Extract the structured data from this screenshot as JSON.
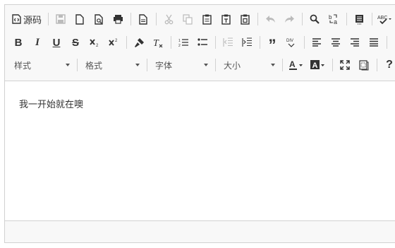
{
  "toolbar": {
    "source_label": "源码",
    "styles_label": "样式",
    "format_label": "格式",
    "font_label": "字体",
    "size_label": "大小"
  },
  "content": {
    "text": "我一开始就在噢"
  },
  "colors": {
    "toolbar_bg": "#f8f8f8",
    "border": "#d1d1d1",
    "icon": "#333333",
    "icon_disabled": "#bbbbbb"
  }
}
